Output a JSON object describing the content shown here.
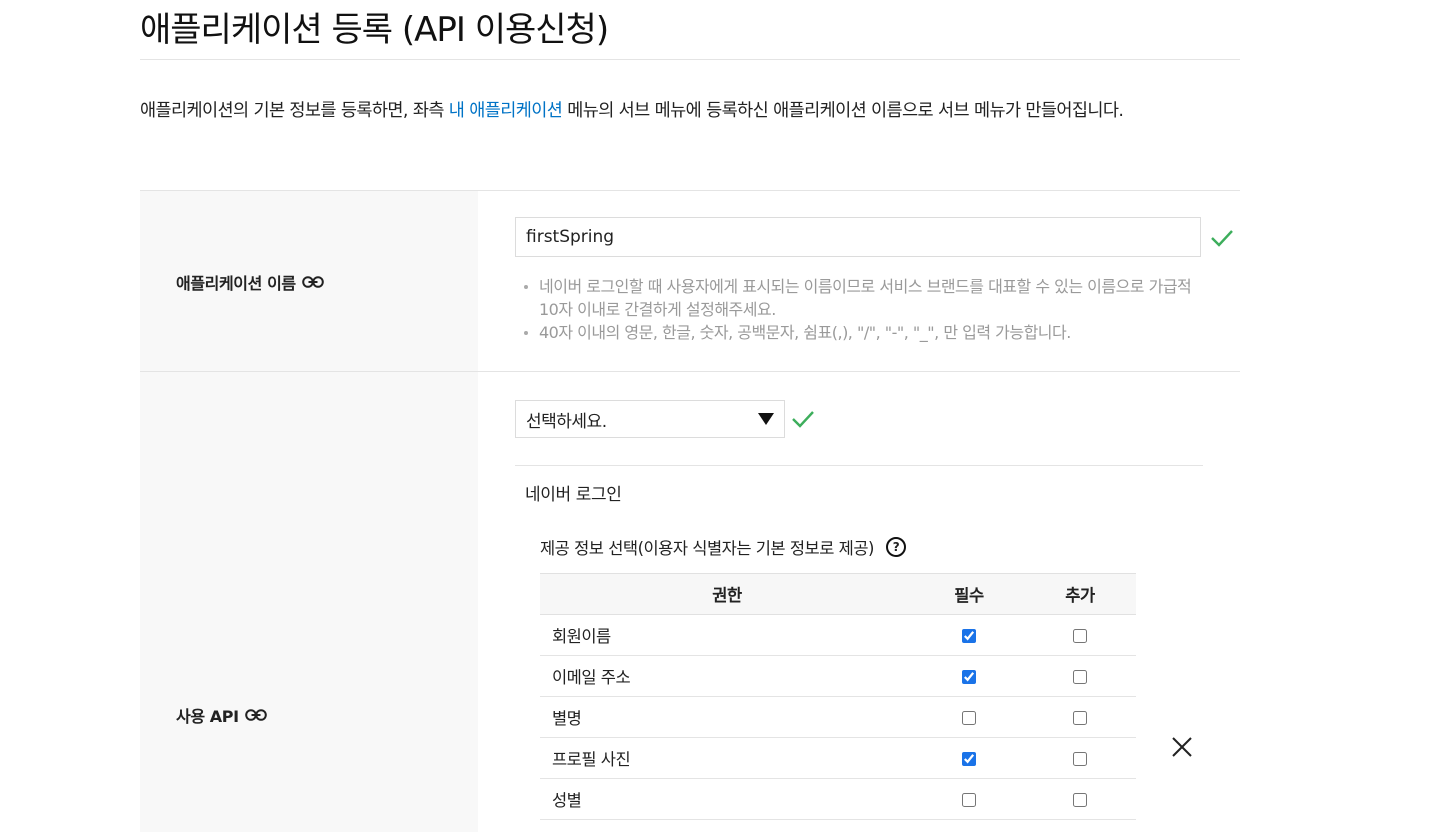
{
  "page": {
    "title": "애플리케이션 등록 (API 이용신청)",
    "intro_before": "애플리케이션의 기본 정보를 등록하면, 좌측 ",
    "intro_link": "내 애플리케이션",
    "intro_after": " 메뉴의 서브 메뉴에 등록하신 애플리케이션 이름으로 서브 메뉴가 만들어집니다."
  },
  "app_name": {
    "label": "애플리케이션 이름",
    "label_icon": "link-icon",
    "value": "firstSpring",
    "valid": true,
    "valid_icon": "check-icon",
    "hints": [
      "네이버 로그인할 때 사용자에게 표시되는 이름이므로 서비스 브랜드를 대표할 수 있는 이름으로 가급적 10자 이내로 간결하게 설정해주세요.",
      "40자 이내의 영문, 한글, 숫자, 공백문자, 쉼표(,), \"/\", \"-\", \"_\", 만 입력 가능합니다."
    ]
  },
  "api": {
    "label": "사용 API",
    "label_icon": "link-icon",
    "select_value": "선택하세요.",
    "valid": true,
    "selected_api": "네이버 로그인",
    "info_heading": "제공 정보 선택(이용자 식별자는 기본 정보로 제공)",
    "help_icon": "question-circle-icon",
    "help_glyph": "?",
    "table": {
      "headers": [
        "권한",
        "필수",
        "추가"
      ],
      "rows": [
        {
          "name": "회원이름",
          "required": true,
          "optional": false
        },
        {
          "name": "이메일 주소",
          "required": true,
          "optional": false
        },
        {
          "name": "별명",
          "required": false,
          "optional": false
        },
        {
          "name": "프로필 사진",
          "required": true,
          "optional": false
        },
        {
          "name": "성별",
          "required": false,
          "optional": false
        }
      ]
    },
    "remove_icon": "close-icon"
  },
  "colors": {
    "link": "#0073c6",
    "valid": "#3dae5c",
    "label_bg": "#f8f8f8",
    "hint_text": "#9a9a9a",
    "checkbox": "#1a73e8"
  }
}
